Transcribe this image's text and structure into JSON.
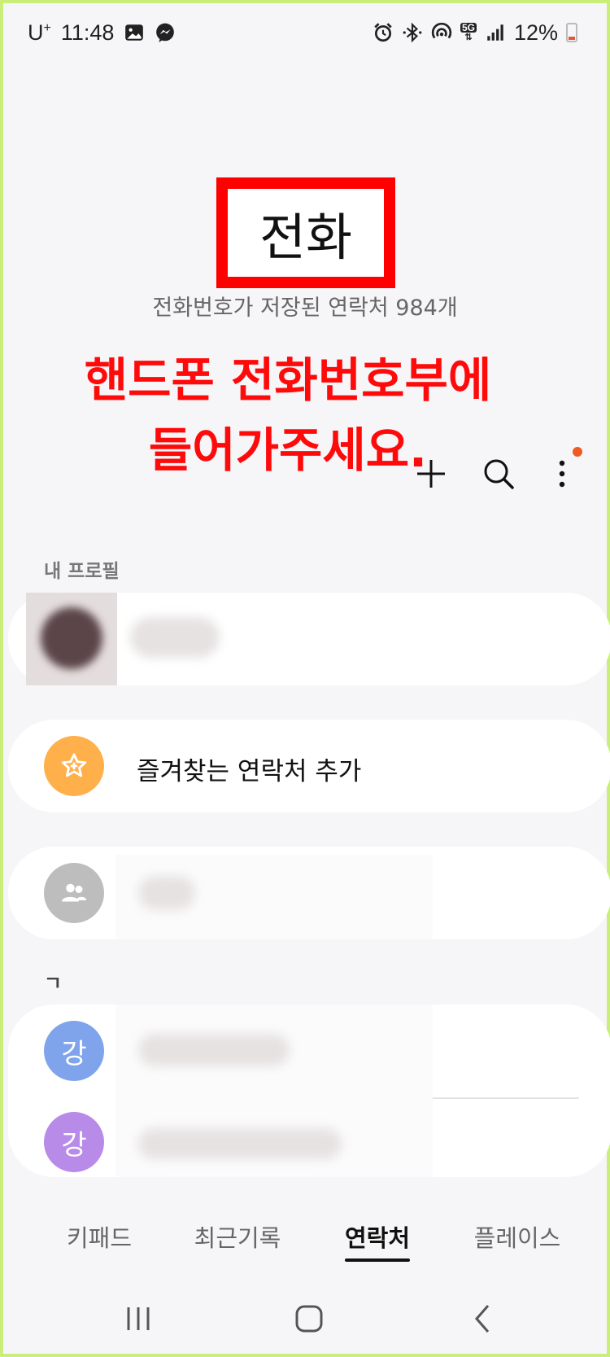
{
  "status_bar": {
    "carrier": "U",
    "carrier_sup": "+",
    "time": "11:48",
    "network": "5G",
    "battery": "12%",
    "icons": [
      "image-icon",
      "messenger-icon",
      "alarm-icon",
      "bluetooth-icon",
      "hotspot-icon",
      "5g-icon",
      "signal-icon",
      "battery-icon"
    ]
  },
  "header": {
    "title": "전화",
    "subtitle": "전화번호가 저장된 연락처 984개"
  },
  "annotation": {
    "line1": "핸드폰 전화번호부에",
    "line2": "들어가주세요."
  },
  "toolbar": {
    "icons": [
      "plus-icon",
      "search-icon",
      "more-vert-icon"
    ]
  },
  "sections": {
    "my_profile": "내 프로필",
    "group_g": "ㄱ"
  },
  "favorites": {
    "label": "즐겨찾는 연락처 추가"
  },
  "contacts": [
    {
      "avatar": "강"
    },
    {
      "avatar": "강"
    }
  ],
  "tabs": [
    "키패드",
    "최근기록",
    "연락처",
    "플레이스"
  ],
  "active_tab": "연락처",
  "colors": {
    "accent_orange": "#FFB04A",
    "avatar_blue": "#7FA4EC",
    "avatar_purple": "#B98BE8",
    "avatar_gray": "#BDBDBD",
    "annotation_red": "#FF0000",
    "notification_dot": "#EF5B25"
  }
}
